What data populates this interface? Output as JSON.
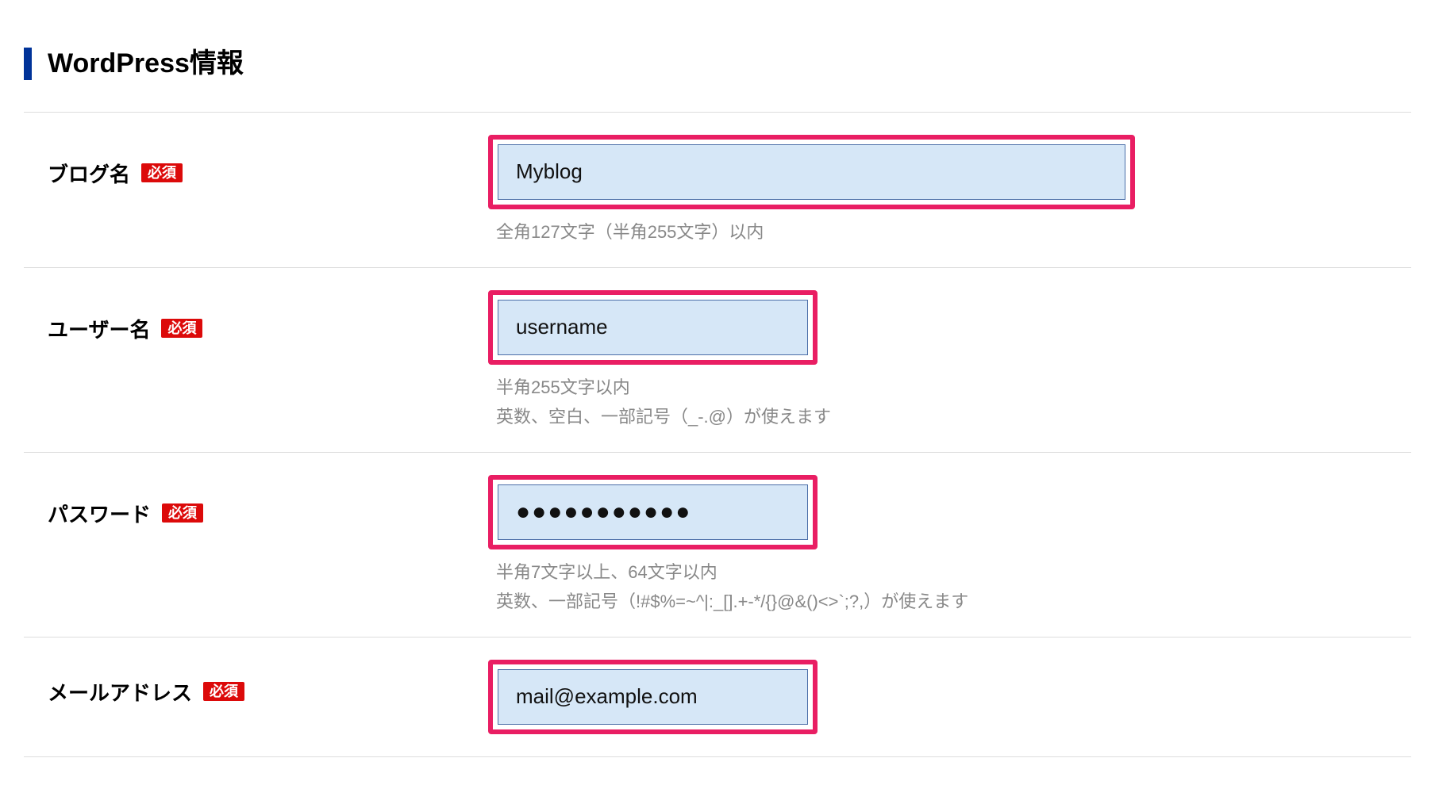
{
  "section_title": "WordPress情報",
  "required_label": "必須",
  "fields": {
    "blog": {
      "label": "ブログ名",
      "value": "Myblog",
      "hint": "全角127文字（半角255文字）以内"
    },
    "username": {
      "label": "ユーザー名",
      "value": "username",
      "hint1": "半角255文字以内",
      "hint2": "英数、空白、一部記号（_-.@）が使えます"
    },
    "password": {
      "label": "パスワード",
      "value": "●●●●●●●●●●●",
      "hint1": "半角7文字以上、64文字以内",
      "hint2": "英数、一部記号（!#$%=~^|:_[].+-*/{}@&()<>`;?,）が使えます"
    },
    "email": {
      "label": "メールアドレス",
      "value": "mail@example.com"
    }
  }
}
